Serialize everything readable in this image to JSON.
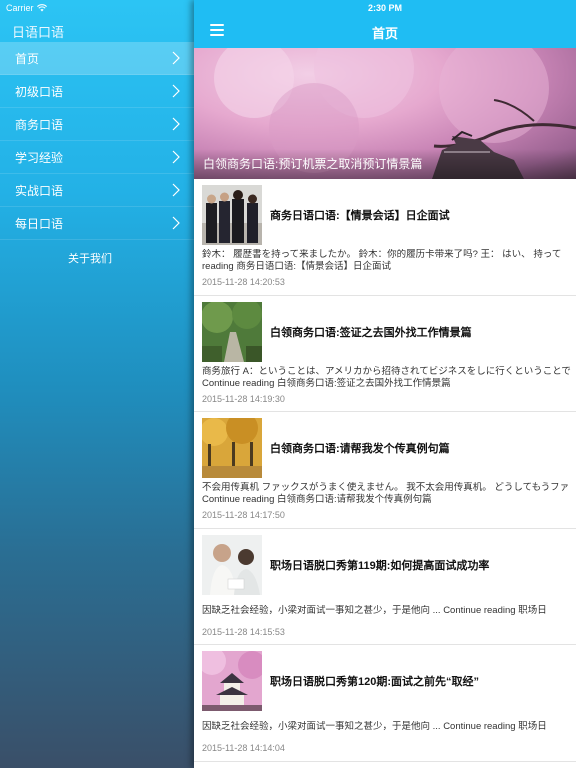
{
  "status": {
    "carrier": "Carrier",
    "time": "2:30 PM"
  },
  "sidebar": {
    "title": "日语口语",
    "items": [
      {
        "label": "首页",
        "active": true
      },
      {
        "label": "初级口语",
        "active": false
      },
      {
        "label": "商务口语",
        "active": false
      },
      {
        "label": "学习经验",
        "active": false
      },
      {
        "label": "实战口语",
        "active": false
      },
      {
        "label": "每日口语",
        "active": false
      }
    ],
    "about": "关于我们"
  },
  "navbar": {
    "title": "首页",
    "menu_icon": "hamburger-menu-icon"
  },
  "banner": {
    "caption": "白领商务口语:预订机票之取消预订情景篇"
  },
  "articles": [
    {
      "title": "商务日语口语:【情景会话】日企面试",
      "excerpt1": "鈴木：  履歴書を持って来ましたか。 鈴木：你的履历卡带来了吗? 王：  はい、 持って",
      "excerpt2": "reading 商务日语口语:【情景会话】日企面试",
      "date": "2015-11-28 14:20:53"
    },
    {
      "title": "白领商务口语:签证之去国外找工作情景篇",
      "excerpt1": "商务旅行 A：ということは、アメリカから招待されてビジネスをしに行くということで",
      "excerpt2": "Continue reading 白领商务口语:签证之去国外找工作情景篇",
      "date": "2015-11-28 14:19:30"
    },
    {
      "title": "白领商务口语:请帮我发个传真例句篇",
      "excerpt1": "不会用传真机 ファックスがうまく使えません。 我不太会用传真机。 どうしてもうファ",
      "excerpt2": "Continue reading 白领商务口语:请帮我发个传真例句篇",
      "date": "2015-11-28 14:17:50"
    },
    {
      "title": "职场日语脱口秀第119期:如何提高面试成功率",
      "excerpt1": "    因缺乏社会经验，小梁对面试一事知之甚少，于是他向 ... Continue reading 职场日",
      "excerpt2": "",
      "date": "2015-11-28 14:15:53"
    },
    {
      "title": "职场日语脱口秀第120期:面试之前先“取经”",
      "excerpt1": "    因缺乏社会经验，小梁对面试一事知之甚少，于是他向 ... Continue reading 职场日",
      "excerpt2": "",
      "date": "2015-11-28 14:14:04"
    }
  ],
  "colors": {
    "navbar": "#1fbdf3",
    "sidebar_top": "#2cc4f4",
    "sidebar_bottom": "#3a4f68"
  }
}
